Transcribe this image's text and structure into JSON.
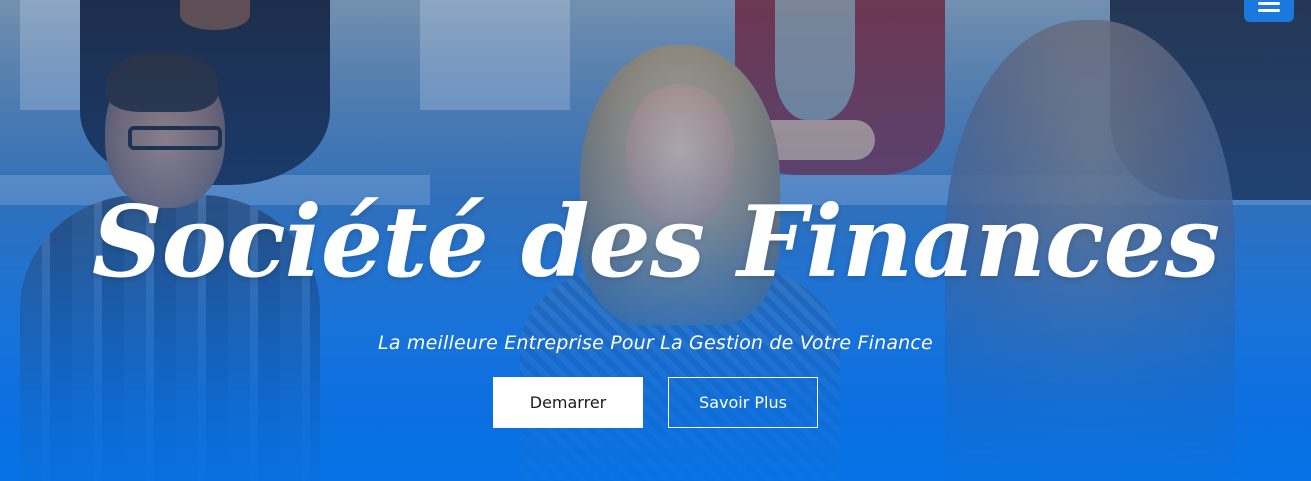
{
  "hero": {
    "title": "Société des Finances",
    "subtitle": "La meilleure Entreprise Pour La Gestion de Votre Finance",
    "primary_button": "Demarrer",
    "secondary_button": "Savoir Plus"
  },
  "nav": {
    "menu_icon": "hamburger-menu-icon"
  },
  "colors": {
    "accent": "#1b78de",
    "overlay_bottom": "#0573e6",
    "text": "#ffffff",
    "primary_button_bg": "#ffffff",
    "primary_button_text": "#1a1a1a"
  }
}
